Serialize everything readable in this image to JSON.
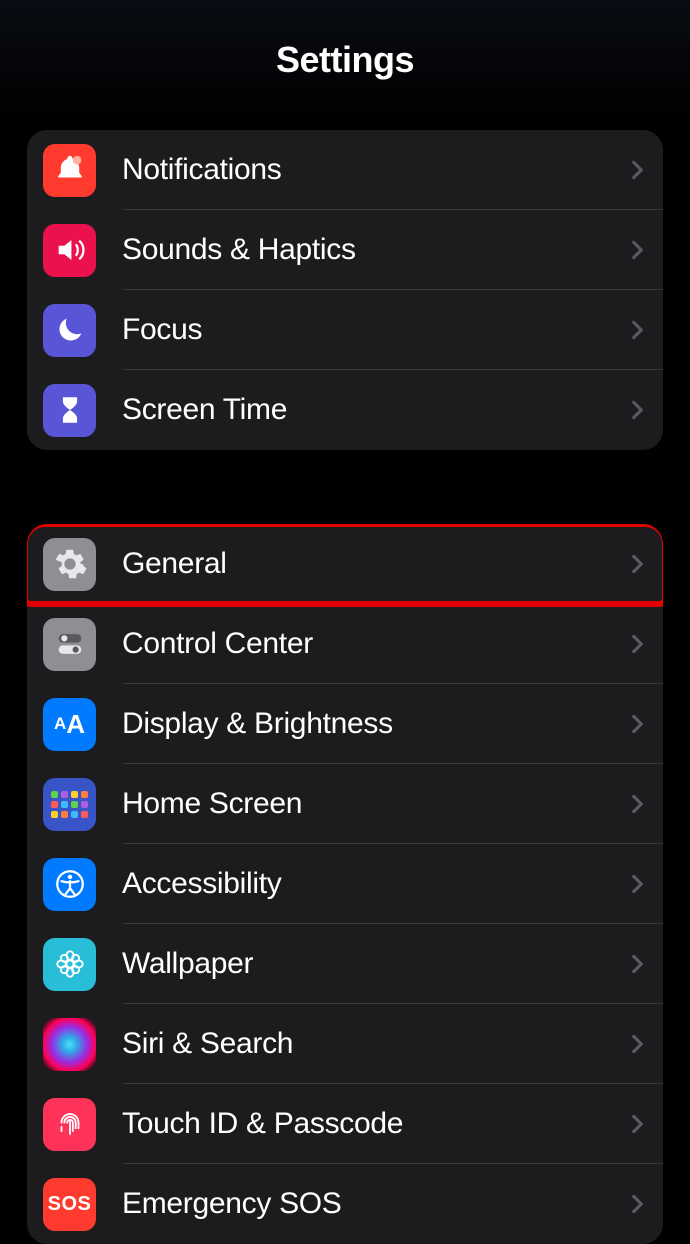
{
  "header": {
    "title": "Settings"
  },
  "groups": [
    {
      "items": [
        {
          "id": "notifications",
          "label": "Notifications",
          "icon": "bell-icon",
          "icon_color": "#ff3b30"
        },
        {
          "id": "sounds",
          "label": "Sounds & Haptics",
          "icon": "speaker-icon",
          "icon_color": "#eb114d"
        },
        {
          "id": "focus",
          "label": "Focus",
          "icon": "moon-icon",
          "icon_color": "#5856d6"
        },
        {
          "id": "screentime",
          "label": "Screen Time",
          "icon": "hourglass-icon",
          "icon_color": "#5856d6"
        }
      ]
    },
    {
      "items": [
        {
          "id": "general",
          "label": "General",
          "icon": "gear-icon",
          "icon_color": "#8e8e93",
          "highlighted": true
        },
        {
          "id": "control",
          "label": "Control Center",
          "icon": "toggles-icon",
          "icon_color": "#8e8e93"
        },
        {
          "id": "display",
          "label": "Display & Brightness",
          "icon": "aa-icon",
          "icon_color": "#007aff"
        },
        {
          "id": "home",
          "label": "Home Screen",
          "icon": "apps-grid-icon",
          "icon_color": "#3854c6"
        },
        {
          "id": "accessibility",
          "label": "Accessibility",
          "icon": "accessibility-icon",
          "icon_color": "#007aff"
        },
        {
          "id": "wallpaper",
          "label": "Wallpaper",
          "icon": "flower-icon",
          "icon_color": "#28bed8"
        },
        {
          "id": "siri",
          "label": "Siri & Search",
          "icon": "siri-icon",
          "icon_color": "gradient"
        },
        {
          "id": "touchid",
          "label": "Touch ID & Passcode",
          "icon": "fingerprint-icon",
          "icon_color": "#ff3259"
        },
        {
          "id": "sos",
          "label": "Emergency SOS",
          "icon": "sos-icon",
          "icon_color": "#ff3b30"
        }
      ]
    }
  ]
}
